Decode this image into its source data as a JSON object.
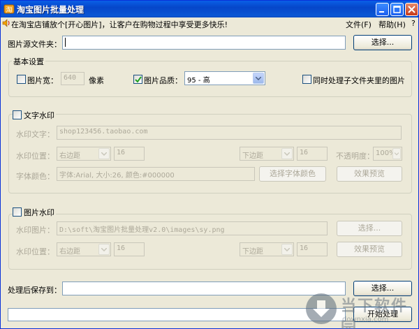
{
  "window": {
    "title": "淘宝图片批量处理"
  },
  "menubar": {
    "marquee": "在淘宝店铺放个[开心图片]，让客户在购物过程中享受更多快乐!",
    "file": "文件(F)",
    "help": "帮助(H)",
    "question": "?"
  },
  "source": {
    "label": "图片源文件夹：",
    "value": "",
    "button": "选择..."
  },
  "basic": {
    "title": "基本设置",
    "width_label": "图片宽：",
    "width_checked": false,
    "width_value": "640",
    "width_unit": "像素",
    "quality_label": "图片品质：",
    "quality_checked": true,
    "quality_value": "95 - 高",
    "subfolder_label": "同时处理子文件夹里的图片",
    "subfolder_checked": false
  },
  "text_wm": {
    "title": "文字水印",
    "checked": false,
    "text_label": "水印文字：",
    "text_value": "shop123456.taobao.com",
    "pos_label": "水印位置：",
    "h_pos": "右边距",
    "h_offset": "16",
    "v_pos": "下边距",
    "v_offset": "16",
    "opacity_label": "不透明度：",
    "opacity_value": "100%",
    "font_color_label": "字体颜色：",
    "font_desc": "字体:Arial, 大小:26, 颜色:#000000",
    "font_button": "选择字体颜色",
    "preview_button": "效果预览"
  },
  "image_wm": {
    "title": "图片水印",
    "checked": false,
    "image_label": "水印图片：",
    "image_value": "D:\\soft\\淘宝图片批量处理v2.0\\images\\sy.png",
    "select_button": "选择...",
    "pos_label": "水印位置：",
    "h_pos": "右边距",
    "h_offset": "16",
    "v_pos": "下边距",
    "v_offset": "16",
    "preview_button": "效果预览"
  },
  "output": {
    "label": "处理后保存到：",
    "value": "",
    "button": "选择..."
  },
  "progress": {
    "value": 0
  },
  "start_button": "开始处理",
  "watermark": {
    "cn": "当下软件园",
    "en": "downxia.com"
  },
  "colors": {
    "titlebar": "#0a5fe6",
    "window_bg": "#ece9d8",
    "disabled_text": "#aca899",
    "accent": "#0831d9"
  }
}
